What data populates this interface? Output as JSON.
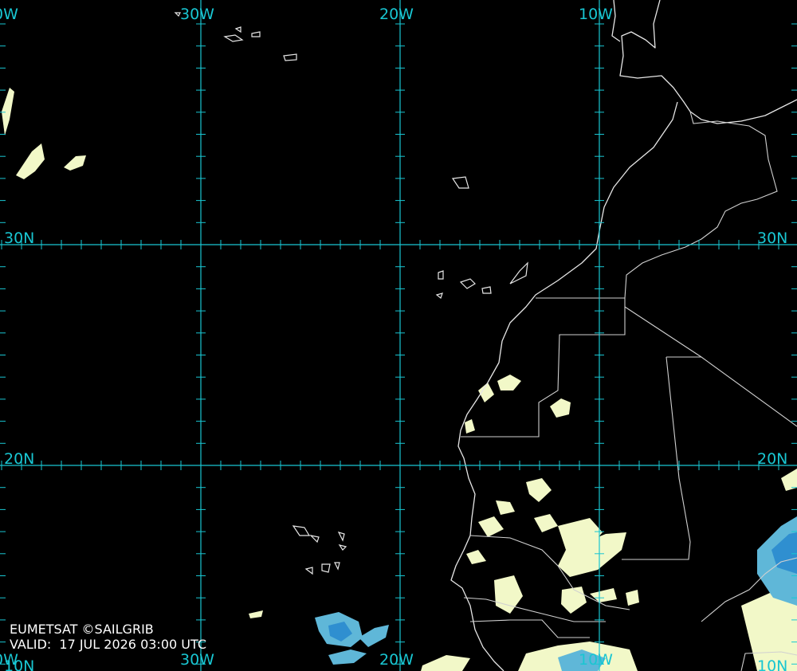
{
  "labels": {
    "lon": [
      "0W",
      "30W",
      "20W",
      "10W"
    ],
    "lat_left": [
      "30N",
      "20N",
      "10N"
    ],
    "lat_right": [
      "30N",
      "20N",
      "10N"
    ],
    "lon_bottom": [
      "0W",
      "30W",
      "20W",
      "10W"
    ]
  },
  "credit": {
    "line1": "EUMETSAT ©SAILGRIB",
    "line2_prefix": "VALID:",
    "valid_time": "17 JUL 2026 03:00 UTC"
  },
  "colors": {
    "background": "#000000",
    "grid": "#19c6d2",
    "coastline": "#e6e6e6",
    "cloud_light": "#f2f8c8",
    "cloud_blue": "#5fb7d8",
    "cloud_deep": "#2f8fd0"
  }
}
